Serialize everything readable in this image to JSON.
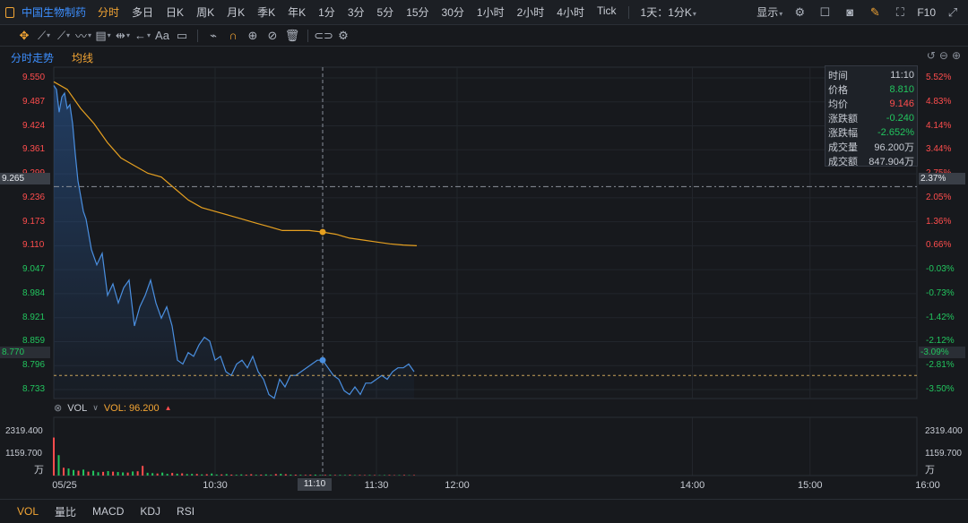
{
  "topbar": {
    "stock_name": "中国生物制药",
    "tabs": [
      "分时",
      "多日",
      "日K",
      "周K",
      "月K",
      "季K",
      "年K",
      "1分",
      "3分",
      "5分",
      "15分",
      "30分",
      "1小时",
      "2小时",
      "4小时",
      "Tick"
    ],
    "active_tab": 0,
    "period_select": "1天：1分K",
    "display_label": "显示",
    "f10_label": "F10"
  },
  "chart_header": {
    "intraday_label": "分时走势",
    "avg_label": "均线"
  },
  "info_box": {
    "rows": [
      {
        "k": "时间",
        "v": "11:10",
        "color": "#c8ccd4"
      },
      {
        "k": "价格",
        "v": "8.810",
        "color": "#22c55e"
      },
      {
        "k": "均价",
        "v": "9.146",
        "color": "#ff4d4d"
      },
      {
        "k": "涨跌额",
        "v": "-0.240",
        "color": "#22c55e"
      },
      {
        "k": "涨跌幅",
        "v": "-2.652%",
        "color": "#22c55e"
      },
      {
        "k": "成交量",
        "v": "96.200万",
        "color": "#c8ccd4"
      },
      {
        "k": "成交额",
        "v": "847.904万",
        "color": "#c8ccd4"
      }
    ]
  },
  "volume_header": {
    "label": "VOL",
    "value_text": "VOL: 96.200"
  },
  "volume_axis": {
    "top": "2319.400",
    "mid": "1159.700",
    "unit": "万"
  },
  "bottom_tabs": [
    "VOL",
    "量比",
    "MACD",
    "KDJ",
    "RSI"
  ],
  "crosshair": {
    "x_label": "11:10",
    "y_price": "9.265",
    "y_pct": "2.37%"
  },
  "last_price": {
    "price": "8.770",
    "pct": "-3.09%"
  },
  "colors": {
    "up": "#ff4d4d",
    "down": "#22c55e",
    "price_line": "#4a8fe0",
    "avg_line": "#e6a020",
    "accent": "#f3a534"
  },
  "chart_data": {
    "type": "line",
    "prev_close": 9.05,
    "price_ticks": [
      "9.550",
      "9.487",
      "9.424",
      "9.361",
      "9.299",
      "9.236",
      "9.173",
      "9.110",
      "9.047",
      "8.984",
      "8.921",
      "8.859",
      "8.796",
      "8.733"
    ],
    "pct_ticks": [
      "5.52%",
      "4.83%",
      "4.14%",
      "3.44%",
      "2.75%",
      "2.05%",
      "1.36%",
      "0.66%",
      "-0.03%",
      "-0.73%",
      "-1.42%",
      "-2.12%",
      "-2.81%",
      "-3.50%"
    ],
    "x_ticks": [
      "05/25",
      "10:30",
      "11:30",
      "12:00",
      "14:00",
      "15:00",
      "16:00"
    ],
    "ylim": [
      8.733,
      9.55
    ],
    "series": [
      {
        "name": "分时",
        "x": [
          "09:30",
          "09:31",
          "09:32",
          "09:33",
          "09:34",
          "09:35",
          "09:36",
          "09:37",
          "09:38",
          "09:39",
          "09:40",
          "09:41",
          "09:42",
          "09:44",
          "09:46",
          "09:48",
          "09:50",
          "09:52",
          "09:54",
          "09:56",
          "09:58",
          "10:00",
          "10:02",
          "10:04",
          "10:06",
          "10:08",
          "10:10",
          "10:12",
          "10:14",
          "10:16",
          "10:18",
          "10:20",
          "10:22",
          "10:24",
          "10:26",
          "10:28",
          "10:30",
          "10:32",
          "10:34",
          "10:36",
          "10:38",
          "10:40",
          "10:42",
          "10:44",
          "10:46",
          "10:48",
          "10:50",
          "10:52",
          "10:54",
          "10:56",
          "10:58",
          "11:00",
          "11:02",
          "11:04",
          "11:06",
          "11:08",
          "11:10",
          "11:12",
          "11:14",
          "11:16",
          "11:18",
          "11:20",
          "11:22",
          "11:24",
          "11:26",
          "11:28",
          "11:30",
          "11:32",
          "11:34",
          "11:36",
          "11:38",
          "11:40",
          "11:42",
          "11:44"
        ],
        "values": [
          9.53,
          9.52,
          9.46,
          9.5,
          9.51,
          9.47,
          9.48,
          9.43,
          9.35,
          9.28,
          9.24,
          9.2,
          9.18,
          9.1,
          9.06,
          9.09,
          8.98,
          9.01,
          8.96,
          9.0,
          9.02,
          8.9,
          8.95,
          8.98,
          9.02,
          8.96,
          8.92,
          8.95,
          8.9,
          8.81,
          8.8,
          8.83,
          8.82,
          8.85,
          8.87,
          8.86,
          8.81,
          8.82,
          8.78,
          8.77,
          8.8,
          8.81,
          8.79,
          8.82,
          8.78,
          8.76,
          8.72,
          8.71,
          8.76,
          8.74,
          8.77,
          8.77,
          8.78,
          8.79,
          8.8,
          8.81,
          8.81,
          8.79,
          8.77,
          8.76,
          8.73,
          8.72,
          8.74,
          8.72,
          8.75,
          8.75,
          8.76,
          8.77,
          8.76,
          8.78,
          8.79,
          8.79,
          8.8,
          8.78
        ]
      },
      {
        "name": "均线",
        "x": [
          "09:30",
          "09:35",
          "09:40",
          "09:45",
          "09:50",
          "09:55",
          "10:00",
          "10:05",
          "10:10",
          "10:15",
          "10:20",
          "10:25",
          "10:30",
          "10:35",
          "10:40",
          "10:45",
          "10:50",
          "10:55",
          "11:00",
          "11:05",
          "11:10",
          "11:15",
          "11:20",
          "11:25",
          "11:30",
          "11:35",
          "11:40",
          "11:45"
        ],
        "values": [
          9.54,
          9.52,
          9.47,
          9.43,
          9.38,
          9.34,
          9.32,
          9.3,
          9.29,
          9.26,
          9.23,
          9.21,
          9.2,
          9.19,
          9.18,
          9.17,
          9.16,
          9.15,
          9.15,
          9.15,
          9.146,
          9.14,
          9.13,
          9.125,
          9.12,
          9.115,
          9.112,
          9.11
        ]
      }
    ],
    "volume": {
      "ylim": [
        0,
        2319.4
      ],
      "values": [
        2050,
        1100,
        420,
        380,
        300,
        260,
        320,
        210,
        260,
        180,
        200,
        240,
        210,
        190,
        170,
        160,
        220,
        230,
        520,
        150,
        130,
        110,
        160,
        90,
        140,
        100,
        120,
        80,
        90,
        85,
        60,
        70,
        110,
        55,
        60,
        75,
        50,
        40,
        60,
        45,
        70,
        40,
        50,
        60,
        40,
        80,
        90,
        70,
        50,
        45,
        40,
        35,
        45,
        50,
        30,
        35,
        40,
        30,
        35,
        30,
        40,
        25,
        30,
        25,
        30,
        25,
        20,
        25,
        30,
        20,
        25,
        30,
        20,
        25
      ],
      "up_flags": [
        1,
        0,
        1,
        0,
        0,
        1,
        0,
        1,
        0,
        0,
        1,
        0,
        1,
        0,
        0,
        1,
        0,
        1,
        1,
        0,
        0,
        1,
        0,
        0,
        1,
        0,
        1,
        0,
        0,
        1,
        0,
        1,
        0,
        0,
        1,
        0,
        1,
        0,
        0,
        1,
        1,
        0,
        1,
        0,
        0,
        1,
        0,
        1,
        0,
        1,
        0,
        1,
        1,
        0,
        0,
        1,
        0,
        1,
        0,
        0,
        1,
        0,
        1,
        1,
        0,
        1,
        0,
        0,
        1,
        1,
        0,
        1,
        0,
        1
      ]
    }
  }
}
